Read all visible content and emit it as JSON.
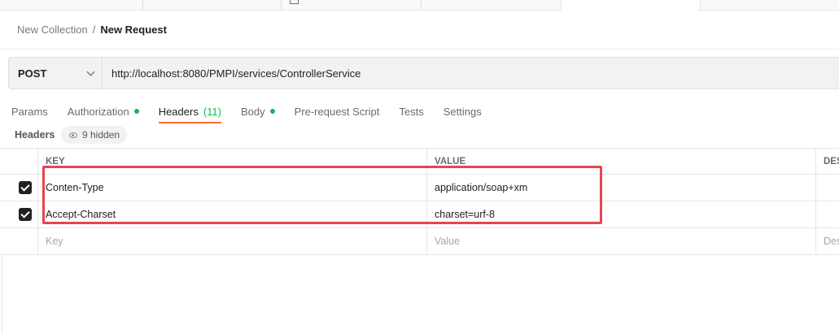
{
  "breadcrumb": {
    "parent": "New Collection",
    "separator": "/",
    "current": "New Request"
  },
  "request": {
    "method": "POST",
    "url": "http://localhost:8080/PMPI/services/ControllerService"
  },
  "tabs": [
    {
      "label": "Params",
      "dot": false
    },
    {
      "label": "Authorization",
      "dot": true
    },
    {
      "label": "Headers",
      "count": "(11)",
      "active": true
    },
    {
      "label": "Body",
      "dot": true
    },
    {
      "label": "Pre-request Script"
    },
    {
      "label": "Tests"
    },
    {
      "label": "Settings"
    }
  ],
  "headers_section": {
    "label": "Headers",
    "hidden_count": "9 hidden"
  },
  "table": {
    "columns": {
      "key": "KEY",
      "value": "VALUE",
      "description": "DES"
    },
    "rows": [
      {
        "checked": true,
        "key": "Conten-Type",
        "value": "application/soap+xm"
      },
      {
        "checked": true,
        "key": "Accept-Charset",
        "value": "charset=urf-8"
      }
    ],
    "placeholder": {
      "key": "Key",
      "value": "Value",
      "description": "Des"
    }
  },
  "colors": {
    "accent": "#ff6c37",
    "status_dot": "#0cbb52",
    "highlight": "#e5464f"
  },
  "icons": {
    "method_dropdown": "chevron-down-icon",
    "hidden_toggle": "eye-icon",
    "row_checkbox": "checkbox-checked-icon"
  }
}
